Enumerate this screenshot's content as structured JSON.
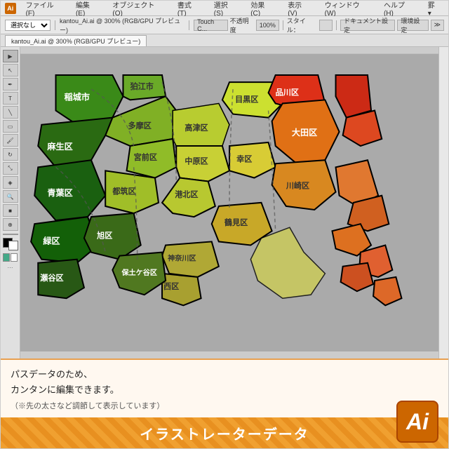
{
  "app": {
    "title": "Adobe Illustrator",
    "logo": "Ai",
    "logo_bg": "#cc6600"
  },
  "titlebar": {
    "menus": [
      "ファイル(F)",
      "編集(E)",
      "オブジェクト(O)",
      "書式(T)",
      "選択(S)",
      "効果(C)",
      "表示(V)",
      "ウィンドウ(W)",
      "ヘルプ(H)",
      "罫 ▾"
    ]
  },
  "toolbar": {
    "select_label": "選択なし",
    "file_name": "kantou_Ai.ai @ 300% (RGB/GPU プレビュー)",
    "touch_label": "Touch C...",
    "opacity_label": "不透明度",
    "opacity_value": "100%",
    "style_label": "スタイル：",
    "doc_settings": "ドキュメント設定",
    "env_settings": "環境設定"
  },
  "map": {
    "regions": [
      {
        "name": "稲城市",
        "color": "#4a9a2a",
        "text_color": "#fff"
      },
      {
        "name": "狛江市",
        "color": "#7ab82a",
        "text_color": "#333"
      },
      {
        "name": "多摩区",
        "color": "#8aba30",
        "text_color": "#333"
      },
      {
        "name": "高津区",
        "color": "#c8d840",
        "text_color": "#333"
      },
      {
        "name": "目黒区",
        "color": "#d8e840",
        "text_color": "#333"
      },
      {
        "name": "品川区",
        "color": "#e83820",
        "text_color": "#fff"
      },
      {
        "name": "麻生区",
        "color": "#3a8a1a",
        "text_color": "#fff"
      },
      {
        "name": "宮前区",
        "color": "#a0c030",
        "text_color": "#333"
      },
      {
        "name": "中原区",
        "color": "#d0d840",
        "text_color": "#333"
      },
      {
        "name": "大田区",
        "color": "#e87818",
        "text_color": "#fff"
      },
      {
        "name": "青葉区",
        "color": "#2a7a18",
        "text_color": "#fff"
      },
      {
        "name": "都筑区",
        "color": "#b0c830",
        "text_color": "#333"
      },
      {
        "name": "港北区",
        "color": "#c8d038",
        "text_color": "#333"
      },
      {
        "name": "幸区",
        "color": "#e0d040",
        "text_color": "#333"
      },
      {
        "name": "川崎区",
        "color": "#e09020",
        "text_color": "#333"
      },
      {
        "name": "緑区",
        "color": "#1a6a10",
        "text_color": "#fff"
      },
      {
        "name": "旭区",
        "color": "#508020",
        "text_color": "#fff"
      },
      {
        "name": "鶴見区",
        "color": "#d0b030",
        "text_color": "#333"
      },
      {
        "name": "神奈川区",
        "color": "#c0b838",
        "text_color": "#333"
      },
      {
        "name": "西区",
        "color": "#b8b040",
        "text_color": "#333"
      },
      {
        "name": "保土ケ谷区",
        "color": "#688828",
        "text_color": "#fff"
      },
      {
        "name": "瀬谷区",
        "color": "#386818",
        "text_color": "#fff"
      }
    ]
  },
  "info_panel": {
    "line1": "パスデータのため、",
    "line2": "カンタンに編集できます。",
    "line3": "（※先の太さなど調節して表示しています）"
  },
  "bottom_bar": {
    "title": "イラストレーターデータ",
    "ai_logo": "Ai"
  },
  "tools": [
    "▶",
    "✏",
    "T",
    "⬛",
    "◯",
    "🖊",
    "✂",
    "⟲",
    "↔",
    "🔍",
    "🎨",
    "▦",
    "⬜",
    "⬛"
  ]
}
